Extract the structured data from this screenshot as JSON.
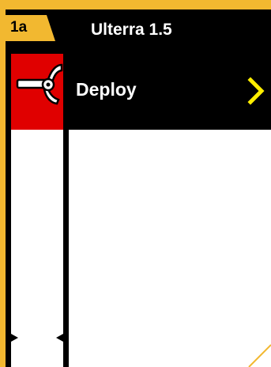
{
  "header": {
    "tag_label": "1a",
    "title": "Ulterra 1.5"
  },
  "menu": {
    "item_label": "Deploy",
    "item_icon": "motor-deploy-icon",
    "nav_icon": "chevron-right-icon"
  },
  "colors": {
    "frame": "#f2b830",
    "screen": "#000000",
    "icon_bg": "#e00000",
    "chevron": "#ffee00",
    "content": "#ffffff"
  }
}
